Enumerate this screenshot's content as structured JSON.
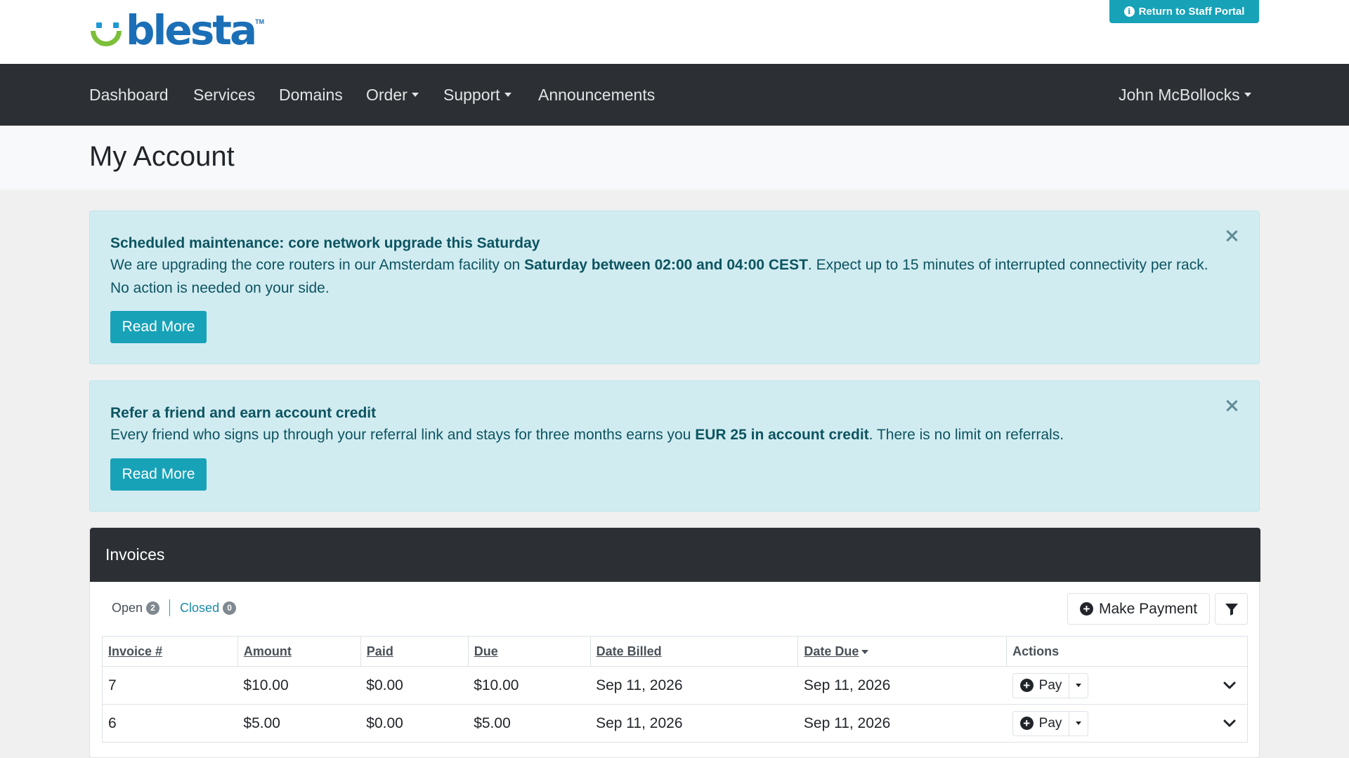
{
  "header": {
    "logo_text": "blesta",
    "logo_tm": "TM",
    "staff_portal_label": "Return to Staff Portal",
    "colors": {
      "logo_blue": "#1b6fb6",
      "logo_green": "#7cbf3a",
      "accent": "#17a2b8"
    }
  },
  "nav": {
    "items": [
      {
        "label": "Dashboard"
      },
      {
        "label": "Services"
      },
      {
        "label": "Domains"
      },
      {
        "label": "Order",
        "dropdown": true
      },
      {
        "label": "Support",
        "dropdown": true
      },
      {
        "label": "Announcements"
      }
    ],
    "user_label": "John McBollocks"
  },
  "page": {
    "title": "My Account"
  },
  "alerts": [
    {
      "title": "Scheduled maintenance: core network upgrade this Saturday",
      "body_pre": "We are upgrading the core routers in our Amsterdam facility on ",
      "body_bold": "Saturday between 02:00 and 04:00 CEST",
      "body_post": ". Expect up to 15 minutes of interrupted connectivity per rack. No action is needed on your side.",
      "button_label": "Read More"
    },
    {
      "title": "Refer a friend and earn account credit",
      "body_pre": "Every friend who signs up through your referral link and stays for three months earns you ",
      "body_bold": "EUR 25 in account credit",
      "body_post": ". There is no limit on referrals.",
      "button_label": "Read More"
    }
  ],
  "invoices": {
    "title": "Invoices",
    "filters": {
      "open_label": "Open",
      "open_count": "2",
      "closed_label": "Closed",
      "closed_count": "0"
    },
    "make_payment_label": "Make Payment",
    "columns": [
      "Invoice #",
      "Amount",
      "Paid",
      "Due",
      "Date Billed",
      "Date Due",
      "Actions"
    ],
    "rows": [
      {
        "invoice": "7",
        "amount": "$10.00",
        "paid": "$0.00",
        "due": "$10.00",
        "date_billed": "Sep 11, 2026",
        "date_due": "Sep 11, 2026",
        "action": "Pay"
      },
      {
        "invoice": "6",
        "amount": "$5.00",
        "paid": "$0.00",
        "due": "$5.00",
        "date_billed": "Sep 11, 2026",
        "date_due": "Sep 11, 2026",
        "action": "Pay"
      }
    ]
  }
}
